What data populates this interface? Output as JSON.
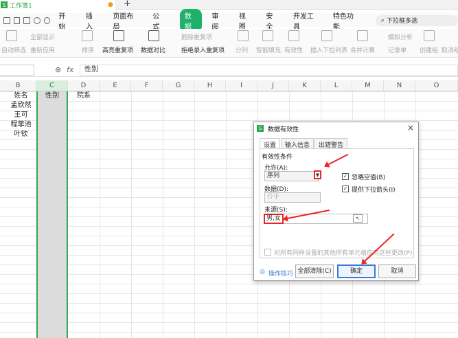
{
  "window": {
    "doc_title": "工作簿1",
    "new_tab": "+"
  },
  "menu": [
    "开始",
    "插入",
    "页面布局",
    "公式",
    "数据",
    "审阅",
    "视图",
    "安全",
    "开发工具",
    "特色功能"
  ],
  "menu_active": "数据",
  "search": {
    "placeholder": "下拉框多选"
  },
  "ribbon": {
    "autofilter": "自动筛选",
    "show_all": "全部显示",
    "reapply": "重新应用",
    "sort": "排序",
    "highlight_dup": "高亮重复项",
    "data_compare": "数据对比",
    "delete_dup": "删除重复项",
    "reject_dup": "拒绝录入重复项",
    "split": "分列",
    "smart_fill": "智能填充",
    "validity": "有效性",
    "insert_dropdown": "插入下拉列表",
    "consolidate": "合并计算",
    "simulate": "模拟分析",
    "record": "记录单",
    "group": "创建组",
    "ungroup": "取消组"
  },
  "formula": {
    "fx": "fx",
    "value": "性别"
  },
  "columns": [
    "B",
    "C",
    "D",
    "E",
    "F",
    "G",
    "H",
    "I",
    "J",
    "K",
    "L",
    "M",
    "N",
    "O"
  ],
  "cells": {
    "b1": "姓名",
    "c1": "性别",
    "d1": "院系",
    "b2": "孟欣然",
    "b3": "王可",
    "b4": "程菲池",
    "b5": "叶钦"
  },
  "dialog": {
    "title": "数据有效性",
    "close": "×",
    "tabs": [
      "设置",
      "输入信息",
      "出错警告"
    ],
    "section": "有效性条件",
    "allow_label": "允许(A):",
    "allow_value": "序列",
    "ignore_blank": "忽略空值(B)",
    "dropdown_arrow": "提供下拉箭头(I)",
    "data_label": "数据(D):",
    "data_value": "介于",
    "source_label": "来源(S):",
    "source_value": "男,女",
    "apply_all": "对所有同样设置的其他所有单元格应用这些更改(P)",
    "tips": "操作技巧",
    "clear_all": "全部清除(C)",
    "ok": "确定",
    "cancel": "取消"
  },
  "colors": {
    "accent": "#2fa84f",
    "annotation": "#e22222",
    "primary_button": "#3a7bd5"
  }
}
